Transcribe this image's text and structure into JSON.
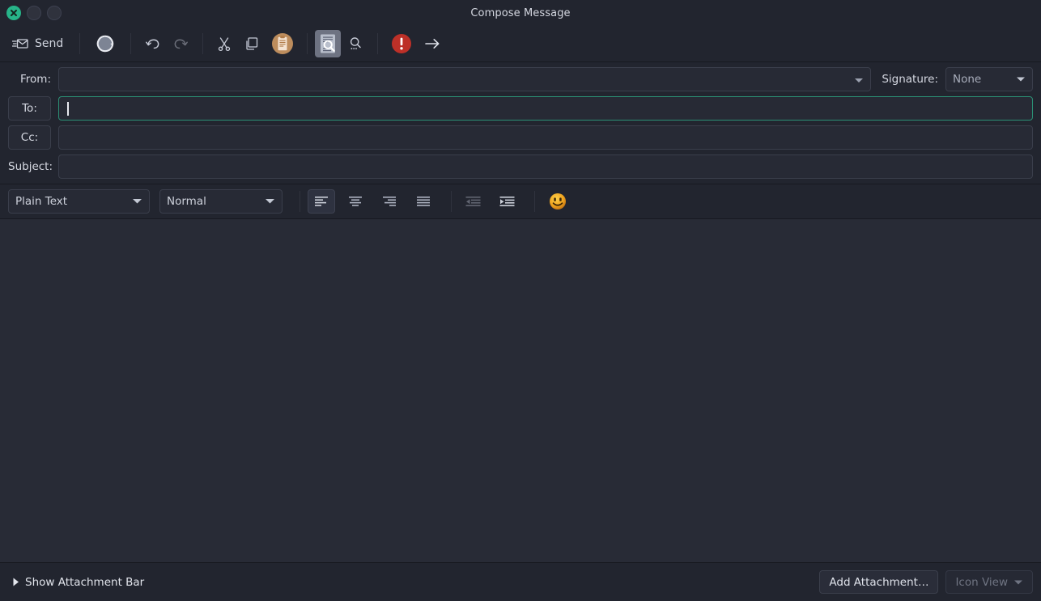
{
  "window": {
    "title": "Compose Message",
    "controls": [
      {
        "name": "close",
        "icon": "close-icon",
        "color": "#27b489"
      },
      {
        "name": "minimize",
        "icon": "minimize-icon",
        "color": "#2f323d"
      },
      {
        "name": "maximize",
        "icon": "maximize-icon",
        "color": "#2f323d"
      }
    ]
  },
  "toolbar": {
    "send_label": "Send",
    "items": [
      {
        "name": "send-button",
        "icon": "send-envelope-icon",
        "label": "Send",
        "enabled": true
      },
      {
        "name": "save-draft-button",
        "icon": "save-circle-icon",
        "label": "",
        "enabled": true
      },
      {
        "name": "undo-button",
        "icon": "undo-icon",
        "label": "",
        "enabled": true
      },
      {
        "name": "redo-button",
        "icon": "redo-icon",
        "label": "",
        "enabled": false
      },
      {
        "name": "cut-button",
        "icon": "scissors-icon",
        "label": "",
        "enabled": true
      },
      {
        "name": "copy-button",
        "icon": "copy-icon",
        "label": "",
        "enabled": true
      },
      {
        "name": "paste-button",
        "icon": "paste-clipboard-icon",
        "label": "",
        "enabled": true
      },
      {
        "name": "find-button",
        "icon": "document-search-icon",
        "label": "",
        "enabled": true,
        "active": true
      },
      {
        "name": "spellcheck-button",
        "icon": "spellcheck-magnifier-icon",
        "label": "",
        "enabled": true
      },
      {
        "name": "priority-button",
        "icon": "priority-exclamation-icon",
        "label": "",
        "enabled": true
      },
      {
        "name": "next-button",
        "icon": "arrow-right-icon",
        "label": "",
        "enabled": true
      }
    ]
  },
  "headers": {
    "from": {
      "label": "From:",
      "value": "",
      "placeholder": ""
    },
    "to": {
      "label": "To:",
      "value": "",
      "placeholder": "",
      "focused": true
    },
    "cc": {
      "label": "Cc:",
      "value": "",
      "placeholder": ""
    },
    "subject": {
      "label": "Subject:",
      "value": "",
      "placeholder": ""
    },
    "signature": {
      "label": "Signature:",
      "value": "None"
    }
  },
  "format_bar": {
    "format_select": {
      "value": "Plain Text"
    },
    "style_select": {
      "value": "Normal"
    },
    "buttons": [
      {
        "name": "align-left-button",
        "icon": "align-left-icon",
        "active": true,
        "enabled": true
      },
      {
        "name": "align-center-button",
        "icon": "align-center-icon",
        "active": false,
        "enabled": true
      },
      {
        "name": "align-right-button",
        "icon": "align-right-icon",
        "active": false,
        "enabled": true
      },
      {
        "name": "align-justify-button",
        "icon": "align-justify-icon",
        "active": false,
        "enabled": true
      },
      {
        "name": "decrease-indent-button",
        "icon": "decrease-indent-icon",
        "active": false,
        "enabled": false
      },
      {
        "name": "increase-indent-button",
        "icon": "increase-indent-icon",
        "active": false,
        "enabled": true
      },
      {
        "name": "emoji-button",
        "icon": "smiley-face-icon",
        "active": false,
        "enabled": true
      }
    ]
  },
  "compose_body": {
    "value": "",
    "placeholder": ""
  },
  "bottom_bar": {
    "attachment_toggle": {
      "label": "Show Attachment Bar",
      "expanded": false,
      "icon": "triangle-right-icon"
    },
    "add_attachment": {
      "label": "Add Attachment…",
      "enabled": true
    },
    "view_mode": {
      "label": "Icon View",
      "enabled": false,
      "icon": "chevron-down-icon"
    }
  },
  "colors": {
    "window_bg": "#22252f",
    "body_bg": "#282b36",
    "field_bg": "#272a35",
    "border": "#3a3e4b",
    "accent_focus": "#2b8f74",
    "close_green": "#27b489",
    "priority_red": "#c0392b",
    "paste_tan": "#c49a6c",
    "text": "#d6d9e2"
  }
}
